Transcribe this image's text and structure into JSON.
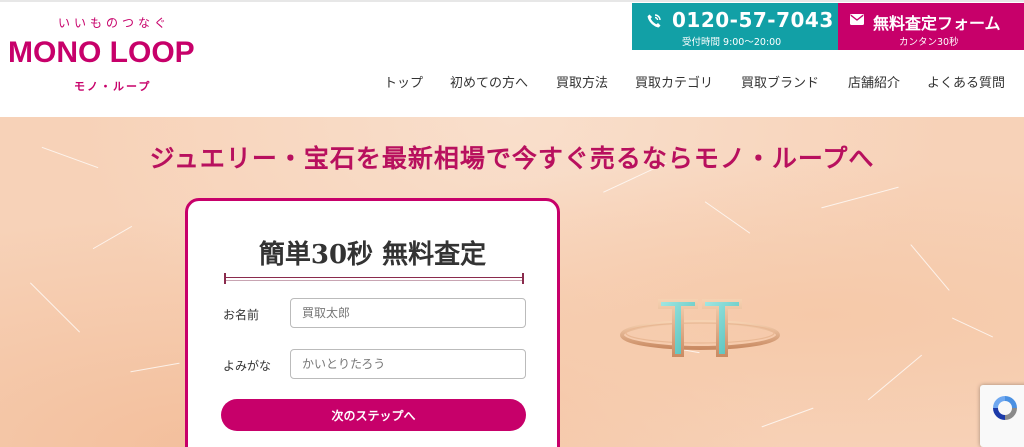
{
  "header": {
    "logo": {
      "tagline": "いいものつなぐ",
      "brand": "MONO LOOP",
      "brand_kana": "モノ・ループ"
    },
    "phone": {
      "number": "0120-57-7043",
      "hours": "受付時間 9:00～20:00",
      "icon": "phone-icon"
    },
    "form": {
      "label": "無料査定フォーム",
      "sub": "カンタン30秒",
      "icon": "mail-icon"
    },
    "nav": [
      "トップ",
      "初めての方へ",
      "買取方法",
      "買取カテゴリ",
      "買取ブランド",
      "店舗紹介",
      "よくある質問"
    ]
  },
  "hero": {
    "headline": "ジュエリー・宝石を最新相場で今すぐ売るならモノ・ループへ",
    "quote_form": {
      "title": "簡単30秒 無料査定",
      "fields": [
        {
          "label": "お名前",
          "placeholder": "買取太郎"
        },
        {
          "label": "よみがな",
          "placeholder": "かいとりたろう"
        }
      ],
      "next_button": "次のステップへ"
    },
    "product_image": "turquoise-t-ring"
  },
  "colors": {
    "brand_magenta": "#c7006a",
    "phone_teal": "#12a0a6",
    "hero_bg": "#f7d2b8"
  }
}
